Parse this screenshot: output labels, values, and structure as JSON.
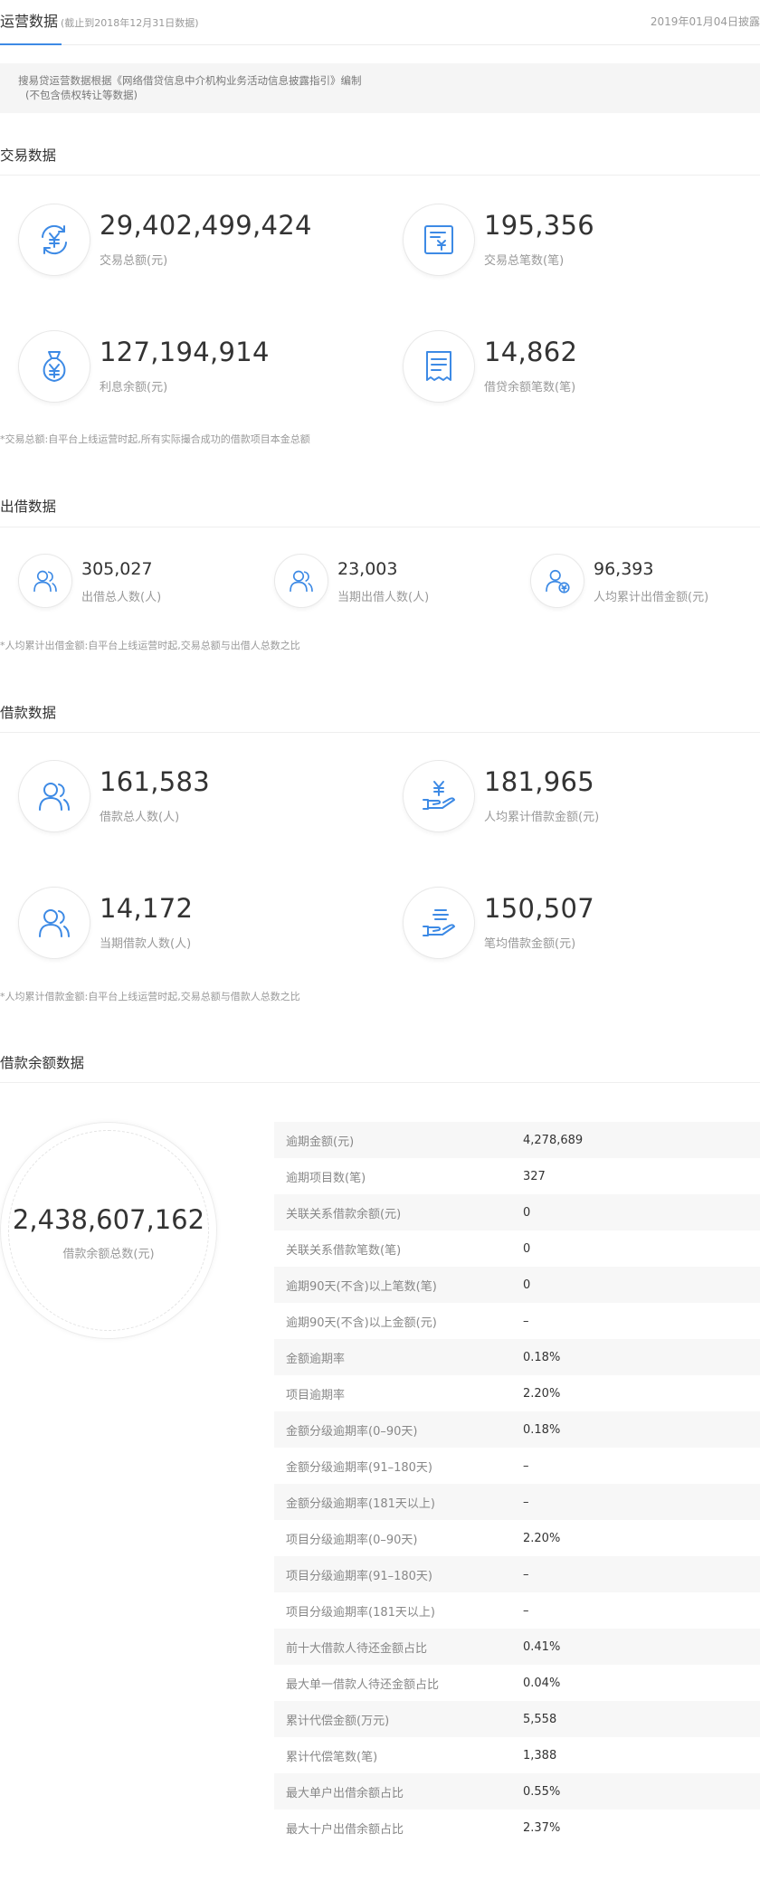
{
  "header": {
    "tab_title": "运营数据",
    "tab_note": "(截止到2018年12月31日数据)",
    "disclosure_date": "2019年01月04日披露"
  },
  "notice": {
    "line1": "搜易贷运营数据根据《网络借贷信息中介机构业务活动信息披露指引》编制",
    "line2": "(不包含债权转让等数据)"
  },
  "accent_color": "#3d8ae5",
  "transaction": {
    "title": "交易数据",
    "stats": [
      {
        "value": "29,402,499,424",
        "label": "交易总额(元)",
        "icon": "yuan-cycle-icon"
      },
      {
        "value": "195,356",
        "label": "交易总笔数(笔)",
        "icon": "invoice-yuan-icon"
      },
      {
        "value": "127,194,914",
        "label": "利息余额(元)",
        "icon": "money-bag-icon"
      },
      {
        "value": "14,862",
        "label": "借贷余额笔数(笔)",
        "icon": "receipt-icon"
      }
    ],
    "footnote": "*交易总额:自平台上线运营时起,所有实际撮合成功的借款项目本金总额"
  },
  "lending": {
    "title": "出借数据",
    "stats": [
      {
        "value": "305,027",
        "label": "出借总人数(人)",
        "icon": "users-icon"
      },
      {
        "value": "23,003",
        "label": "当期出借人数(人)",
        "icon": "users-icon"
      },
      {
        "value": "96,393",
        "label": "人均累计出借金额(元)",
        "icon": "user-yuan-icon"
      }
    ],
    "footnote": "*人均累计出借金额:自平台上线运营时起,交易总额与出借人总数之比"
  },
  "borrowing": {
    "title": "借款数据",
    "stats": [
      {
        "value": "161,583",
        "label": "借款总人数(人)",
        "icon": "users-icon"
      },
      {
        "value": "181,965",
        "label": "人均累计借款金额(元)",
        "icon": "hand-yuan-icon"
      },
      {
        "value": "14,172",
        "label": "当期借款人数(人)",
        "icon": "users-icon"
      },
      {
        "value": "150,507",
        "label": "笔均借款金额(元)",
        "icon": "hand-coins-icon"
      }
    ],
    "footnote": "*人均累计借款金额:自平台上线运营时起,交易总额与借款人总数之比"
  },
  "balance": {
    "title": "借款余额数据",
    "total_value": "2,438,607,162",
    "total_label": "借款余额总数(元)",
    "rows": [
      {
        "label": "逾期金额(元)",
        "value": "4,278,689"
      },
      {
        "label": "逾期项目数(笔)",
        "value": "327"
      },
      {
        "label": "关联关系借款余额(元)",
        "value": "0"
      },
      {
        "label": "关联关系借款笔数(笔)",
        "value": "0"
      },
      {
        "label": "逾期90天(不含)以上笔数(笔)",
        "value": "0"
      },
      {
        "label": "逾期90天(不含)以上金额(元)",
        "value": "–"
      },
      {
        "label": "金额逾期率",
        "value": "0.18%"
      },
      {
        "label": "项目逾期率",
        "value": "2.20%"
      },
      {
        "label": "金额分级逾期率(0–90天)",
        "value": "0.18%"
      },
      {
        "label": "金额分级逾期率(91–180天)",
        "value": "–"
      },
      {
        "label": "金额分级逾期率(181天以上)",
        "value": "–"
      },
      {
        "label": "项目分级逾期率(0–90天)",
        "value": "2.20%"
      },
      {
        "label": "项目分级逾期率(91–180天)",
        "value": "–"
      },
      {
        "label": "项目分级逾期率(181天以上)",
        "value": "–"
      },
      {
        "label": "前十大借款人待还金额占比",
        "value": "0.41%"
      },
      {
        "label": "最大单一借款人待还金额占比",
        "value": "0.04%"
      },
      {
        "label": "累计代偿金额(万元)",
        "value": "5,558"
      },
      {
        "label": "累计代偿笔数(笔)",
        "value": "1,388"
      },
      {
        "label": "最大单户出借余额占比",
        "value": "0.55%"
      },
      {
        "label": "最大十户出借余额占比",
        "value": "2.37%"
      }
    ]
  }
}
